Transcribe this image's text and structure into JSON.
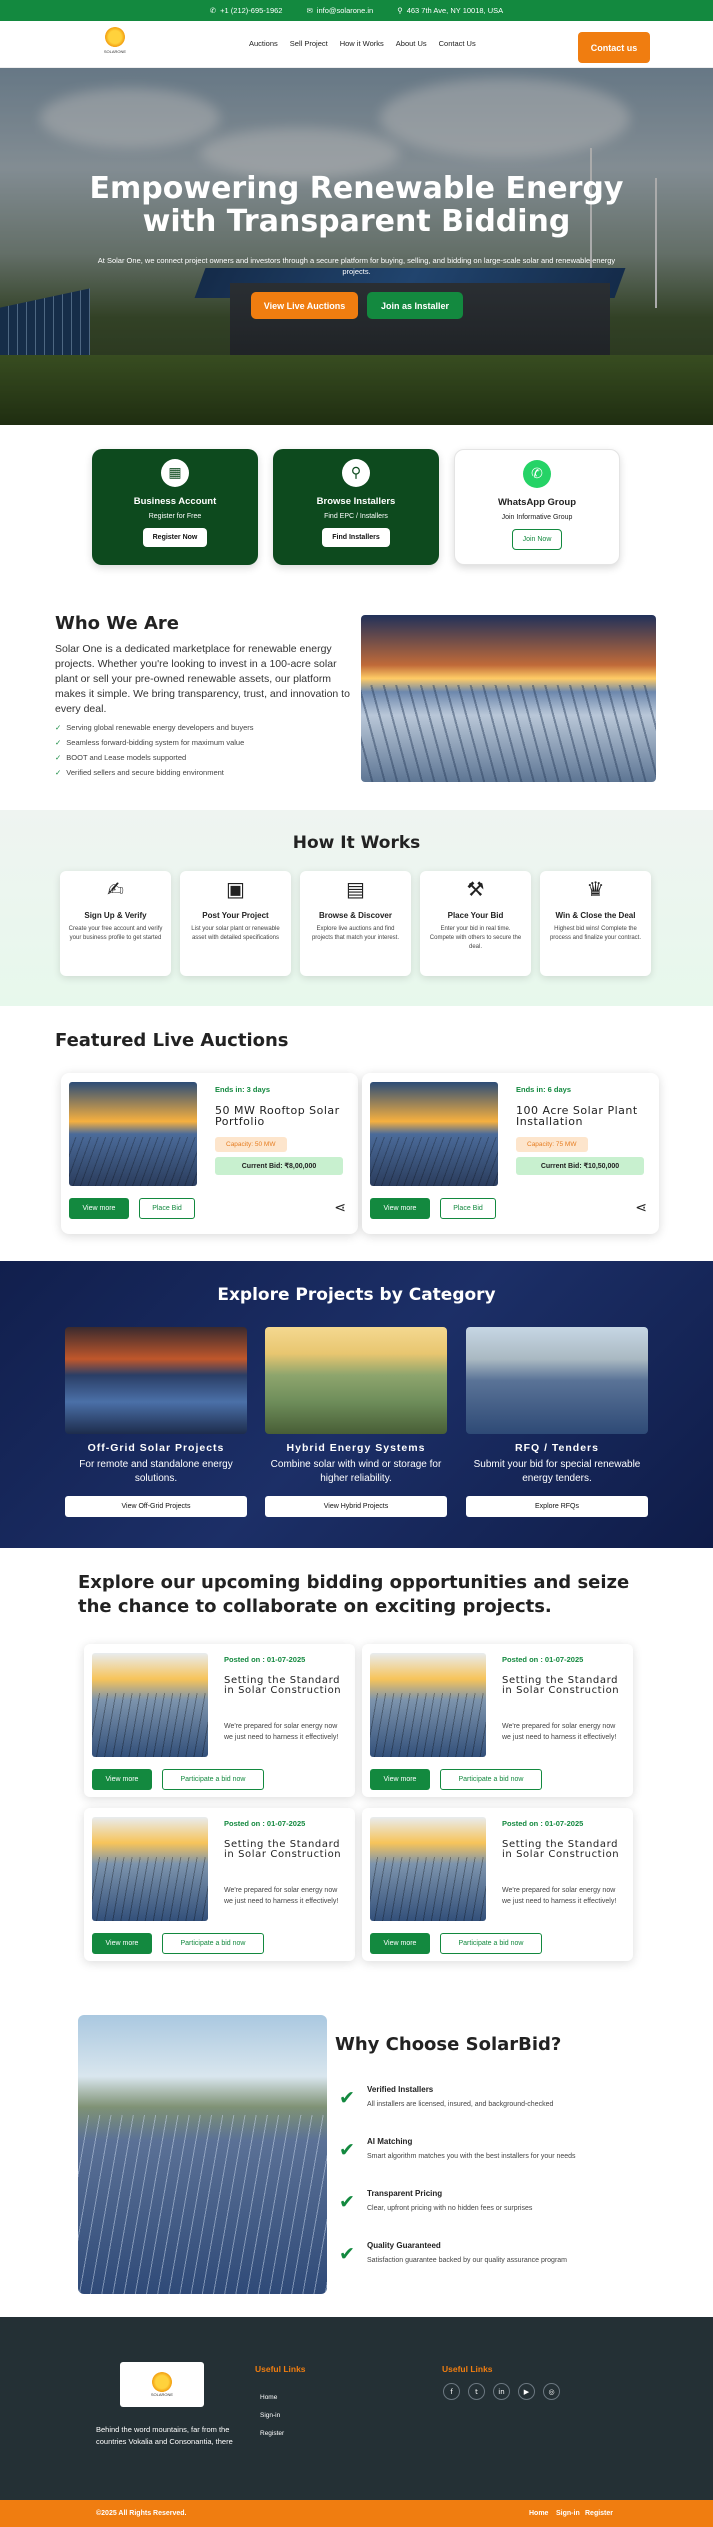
{
  "topbar": {
    "phone": "+1 (212)-695-1962",
    "email": "info@solarone.in",
    "address": "463 7th Ave, NY 10018, USA"
  },
  "logo": {
    "text": "SOLARONE"
  },
  "nav": {
    "items": [
      "Auctions",
      "Sell Project",
      "How it Works",
      "About Us",
      "Contact Us"
    ],
    "cta": "Contact us"
  },
  "hero": {
    "title_line1": "Empowering Renewable Energy",
    "title_line2": "with Transparent Bidding",
    "subtitle": "At Solar One, we connect project owners and investors through a secure platform for buying, selling, and bidding on large-scale solar and renewable energy projects.",
    "btn_primary": "View Live Auctions",
    "btn_secondary": "Join as Installer"
  },
  "quick_cards": [
    {
      "title": "Business Account",
      "sub": "Register for Free",
      "button": "Register Now",
      "icon": "building-icon"
    },
    {
      "title": "Browse Installers",
      "sub": "Find EPC / Installers",
      "button": "Find Installers",
      "icon": "search-icon"
    },
    {
      "title": "WhatsApp Group",
      "sub": "Join Informative Group",
      "button": "Join Now",
      "icon": "whatsapp-icon"
    }
  ],
  "who": {
    "title": "Who We Are",
    "body": "Solar One is a dedicated marketplace for renewable energy projects. Whether you're looking to invest in a 100-acre solar plant or sell your pre-owned renewable assets, our platform makes it simple. We bring transparency, trust, and innovation to every deal.",
    "points": [
      "Serving global renewable energy developers and buyers",
      "Seamless forward-bidding system for maximum value",
      "BOOT and Lease models supported",
      "Verified sellers and secure bidding environment"
    ]
  },
  "how": {
    "title": "How It Works",
    "steps": [
      {
        "title": "Sign Up & Verify",
        "desc": "Create your free account and verify your business profile to get started"
      },
      {
        "title": "Post Your Project",
        "desc": "List your solar plant or renewable asset with detailed specifications"
      },
      {
        "title": "Browse & Discover",
        "desc": "Explore live auctions and find projects that match your interest."
      },
      {
        "title": "Place Your Bid",
        "desc": "Enter your bid in real time. Compete with others to secure the deal."
      },
      {
        "title": "Win & Close the Deal",
        "desc": "Highest bid wins! Complete the process and finalize your contract."
      }
    ]
  },
  "featured": {
    "title": "Featured Live Auctions",
    "auctions": [
      {
        "ends": "Ends in: 3 days",
        "title": "50 MW Rooftop Solar Portfolio",
        "capacity": "Capacity: 50 MW",
        "bid": "Current Bid: ₹8,00,000",
        "view": "View more",
        "place": "Place Bid"
      },
      {
        "ends": "Ends in: 6 days",
        "title": "100 Acre Solar Plant Installation",
        "capacity": "Capacity: 75 MW",
        "bid": "Current Bid: ₹10,50,000",
        "view": "View more",
        "place": "Place Bid"
      }
    ]
  },
  "categories": {
    "title": "Explore Projects by Category",
    "items": [
      {
        "title": "Off-Grid Solar Projects",
        "desc": "For remote and standalone energy solutions.",
        "button": "View Off-Grid Projects"
      },
      {
        "title": "Hybrid Energy Systems",
        "desc": "Combine solar with wind or storage for higher reliability.",
        "button": "View Hybrid Projects"
      },
      {
        "title": "RFQ / Tenders",
        "desc": "Submit your bid for special renewable energy tenders.",
        "button": "Explore RFQs"
      }
    ]
  },
  "upcoming": {
    "title": "Explore our upcoming bidding opportunities and seize the chance to collaborate on exciting projects.",
    "items": [
      {
        "date": "Posted on : 01-07-2025",
        "title": "Setting the Standard in Solar Construction",
        "desc": "We're prepared for solar energy now we just need to harness it effectively!",
        "view": "View more",
        "participate": "Participate a bid now"
      },
      {
        "date": "Posted on : 01-07-2025",
        "title": "Setting the Standard in Solar Construction",
        "desc": "We're prepared for solar energy now we just need to harness it effectively!",
        "view": "View more",
        "participate": "Participate a bid now"
      },
      {
        "date": "Posted on : 01-07-2025",
        "title": "Setting the Standard in Solar Construction",
        "desc": "We're prepared for solar energy now we just need to harness it effectively!",
        "view": "View more",
        "participate": "Participate a bid now"
      },
      {
        "date": "Posted on : 01-07-2025",
        "title": "Setting the Standard in Solar Construction",
        "desc": "We're prepared for solar energy now we just need to harness it effectively!",
        "view": "View more",
        "participate": "Participate a bid now"
      }
    ]
  },
  "why": {
    "title": "Why Choose SolarBid?",
    "items": [
      {
        "title": "Verified Installers",
        "desc": "All installers are licensed, insured, and background-checked"
      },
      {
        "title": "AI Matching",
        "desc": "Smart algorithm matches you with the best installers for your needs"
      },
      {
        "title": "Transparent Pricing",
        "desc": "Clear, upfront pricing with no hidden fees or surprises"
      },
      {
        "title": "Quality Guaranteed",
        "desc": "Satisfaction guarantee backed by our quality assurance program"
      }
    ]
  },
  "footer": {
    "about": "Behind the word mountains, far from the countries Vokalia and Consonantia, there",
    "useful_links_title": "Useful Links",
    "links": [
      "Home",
      "Sign-in",
      "Register"
    ],
    "social_title": "Useful Links",
    "social": [
      "f",
      "t",
      "in",
      "▶",
      "◎"
    ],
    "copyright": "©2025 All Rights Reserved.",
    "bottom_links": [
      "Home",
      "Sign-in",
      "Register"
    ]
  }
}
